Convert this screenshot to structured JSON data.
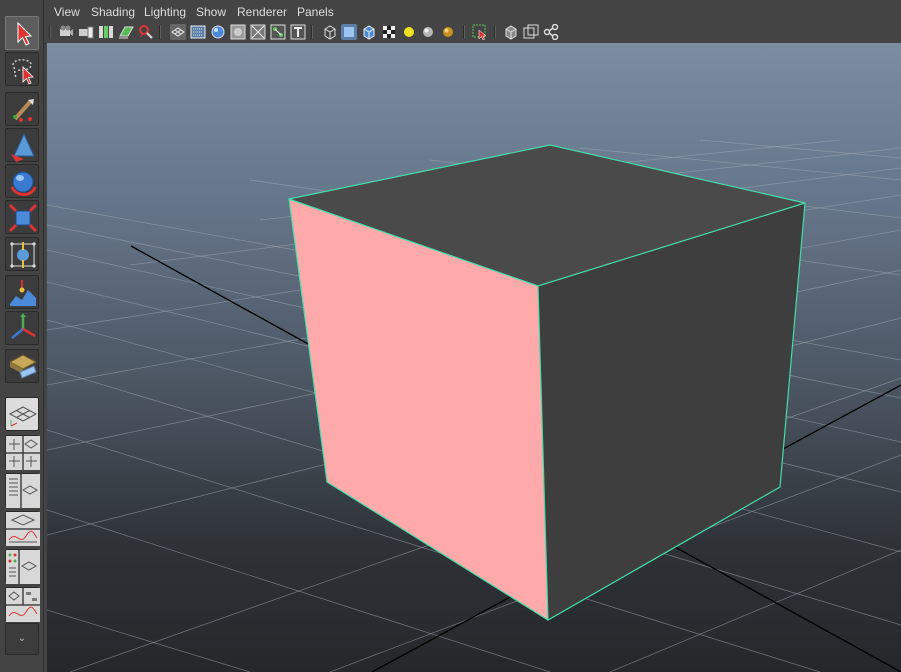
{
  "menubar": {
    "items": [
      "View",
      "Shading",
      "Lighting",
      "Show",
      "Renderer",
      "Panels"
    ]
  },
  "toolbar": {
    "icons": [
      "select-camera-icon",
      "camera-attributes-icon",
      "bookmarks-icon",
      "image-plane-icon",
      "2d-pan-zoom-icon",
      "grease-pencil-icon",
      "grid-icon",
      "film-gate-icon",
      "resolution-gate-icon",
      "gate-mask-icon",
      "field-chart-icon",
      "safe-action-icon",
      "safe-title-icon",
      "wireframe-icon",
      "smooth-shade-icon",
      "wireframe-on-shaded-icon",
      "textured-icon",
      "use-default-light-icon",
      "all-lights-icon",
      "shadows-icon",
      "isolate-select-icon",
      "xray-icon",
      "xray-active-components-icon",
      "xray-joints-icon"
    ]
  },
  "toolbox": {
    "tools": [
      "select-tool-icon",
      "lasso-tool-icon",
      "paint-select-tool-icon",
      "move-tool-icon",
      "rotate-tool-icon",
      "scale-tool-icon",
      "universal-manipulator-icon",
      "soft-modification-icon",
      "show-manipulator-icon",
      "last-tool-used-icon"
    ],
    "layouts": [
      "single-perspective-view-icon",
      "four-view-layout-icon",
      "perspective-outliner-layout-icon",
      "perspective-graph-layout-icon",
      "hypershade-perspective-layout-icon",
      "perspective-graph-hypergraph-layout-icon"
    ],
    "expander_glyph": "⌄"
  },
  "colors": {
    "ui_bg": "#444444",
    "cube_front_face": "#ffaaaa",
    "cube_top_face": "#4a4a4a",
    "cube_right_face": "#3e3e3e",
    "selection_highlight": "#44ddaa",
    "grid_line": "#9aa3ad",
    "axis_line": "#000000"
  }
}
